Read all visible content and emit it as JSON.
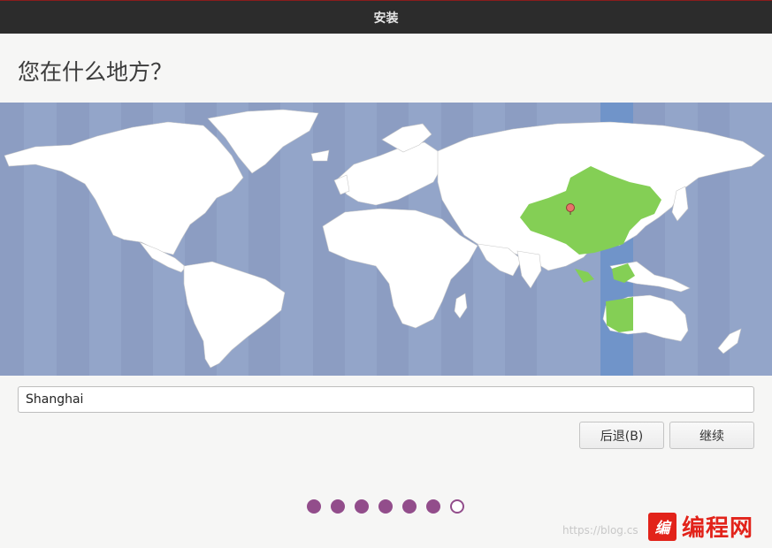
{
  "window": {
    "title": "安装"
  },
  "page": {
    "heading": "您在什么地方？"
  },
  "map": {
    "selected_city_marker": "pin-icon",
    "colors": {
      "ocean": "#93a5c9",
      "land": "#ffffff",
      "selected_timezone_band": "#7094c9",
      "highlighted_region": "#84cf55",
      "pin": "#e8736a"
    }
  },
  "location": {
    "value": "Shanghai"
  },
  "buttons": {
    "back_label": "后退(B)",
    "continue_label": "继续"
  },
  "progress": {
    "total_steps": 7,
    "completed_steps": 6,
    "color": "#924d8b"
  },
  "watermark": {
    "text": "https://blog.cs",
    "logo_mark": "编",
    "logo_text": "编程网"
  }
}
